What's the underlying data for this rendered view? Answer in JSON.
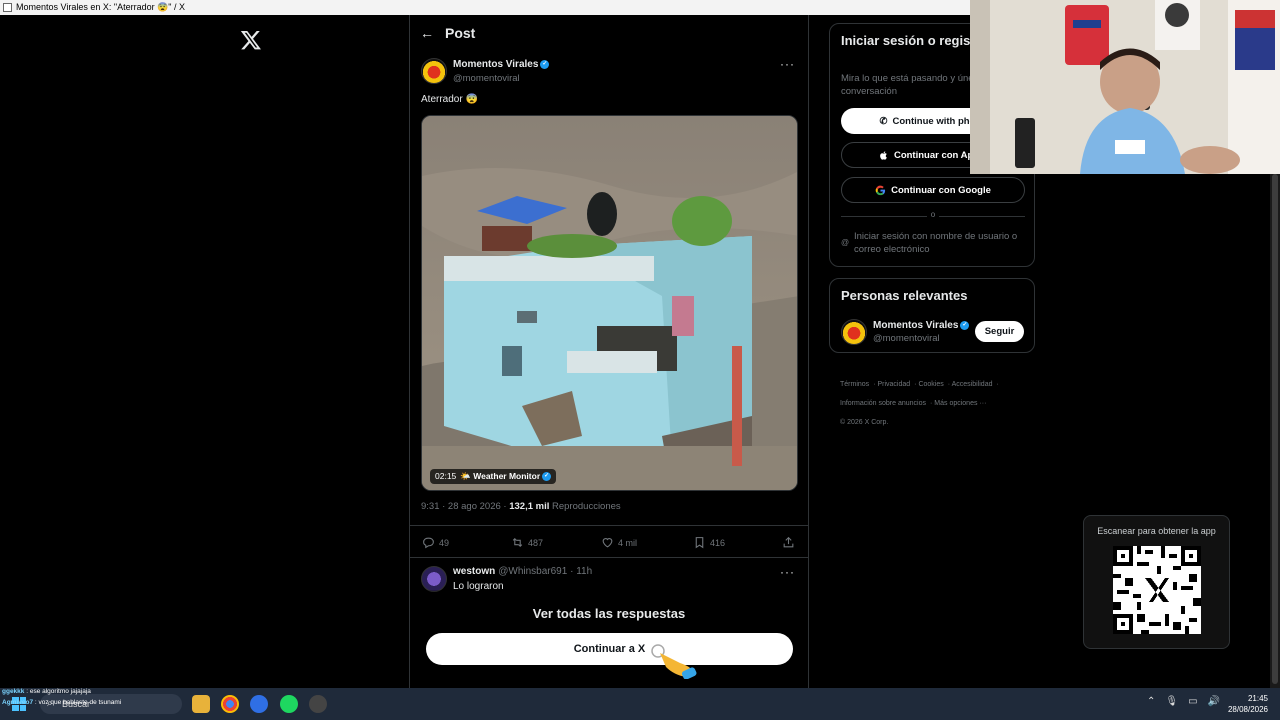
{
  "window": {
    "title": "Momentos Virales en X: \"Aterrador 😨\" / X"
  },
  "header": {
    "title": "Post",
    "back_icon": "arrow-left-icon"
  },
  "post": {
    "author_name": "Momentos Virales",
    "author_handle": "@momentoviral",
    "text": "Aterrador 😨",
    "media": {
      "duration": "02:15",
      "source": "🌤️ Weather Monitor"
    },
    "timestamp": "9:31 · 28 ago 2026 · ",
    "views_count": "132,1 mil",
    "views_label": " Reproducciones",
    "replies": "49",
    "reposts": "487",
    "likes": "4 mil",
    "bookmarks": "416"
  },
  "reply": {
    "name": "westown",
    "handle": "@Whinsbar691 · 11h",
    "text": "Lo lograron"
  },
  "gate": {
    "see_all": "Ver todas las respuestas",
    "continue": "Continuar a X"
  },
  "login": {
    "title": "Iniciar sesión o registrarse en X",
    "subtitle": "Mira lo que está pasando y únete a la conversación",
    "phone": "Continue with phone",
    "apple": "Continuar con Apple",
    "google": "Continuar con Google",
    "or": "o",
    "username": "Iniciar sesión con nombre de usuario o correo electrónico"
  },
  "people": {
    "title": "Personas relevantes",
    "name": "Momentos Virales",
    "handle": "@momentoviral",
    "follow": "Seguir"
  },
  "footer": {
    "links": [
      "Términos",
      "Privacidad",
      "Cookies",
      "Accesibilidad",
      "Información sobre anuncios",
      "Más opciones ···"
    ],
    "copyright": "© 2026 X Corp."
  },
  "qr": {
    "title": "Escanear para obtener la app"
  },
  "chat": [
    {
      "user": "ggekkk",
      "text": "ese algoritmo jajajaja"
    },
    {
      "user": "Agmiveo7",
      "text": "voz que hablaste de tsunami"
    }
  ],
  "taskbar": {
    "search": "Buscar",
    "time": "21:45",
    "date": "28/08/2026"
  },
  "colors": {
    "accent": "#1d9bf0",
    "background": "#000000",
    "border": "#2f3336",
    "muted": "#71767b"
  }
}
